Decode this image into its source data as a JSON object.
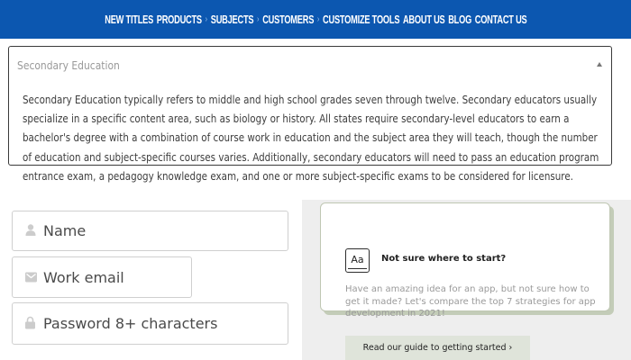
{
  "nav": {
    "new_titles": "NEW TITLES",
    "products": "PRODUCTS",
    "subjects": "SUBJECTS",
    "customers": "CUSTOMERS",
    "customize_tools": "CUSTOMIZE TOOLS",
    "about_us": "ABOUT US",
    "blog": "BLOG",
    "contact_us": "CONTACT US",
    "separator": "›"
  },
  "accordion": {
    "title": "Secondary Education",
    "expanded": true,
    "body": "Secondary Education typically refers to middle and high school grades seven through twelve. Secondary educators usually specialize in a specific content area, such as biology or history. All states require secondary-level educators to earn a bachelor's degree with a combination of course work in education and the subject area they will teach, though the number of education and subject-specific courses varies. Additionally, secondary educators will need to pass an education program entrance exam, a pedagogy knowledge exam, and one or more subject-specific exams to be considered for licensure."
  },
  "form": {
    "name_placeholder": "Name",
    "email_placeholder": "Work email",
    "password_placeholder": "Password 8+ characters"
  },
  "card": {
    "icon_label": "Aa",
    "icon": "book-icon",
    "title": "Not sure where to start?",
    "description": "Have an amazing idea for an app, but not sure how to get it made? Let's compare the top 7 strategies for app development in 2021!",
    "cta": "Read our guide to getting started ›"
  },
  "colors": {
    "nav_bg": "#0c57b0",
    "panel_bg": "#eeeeee",
    "cta_bg": "#dfe4da",
    "card_shadow": "#c3ccb8"
  }
}
